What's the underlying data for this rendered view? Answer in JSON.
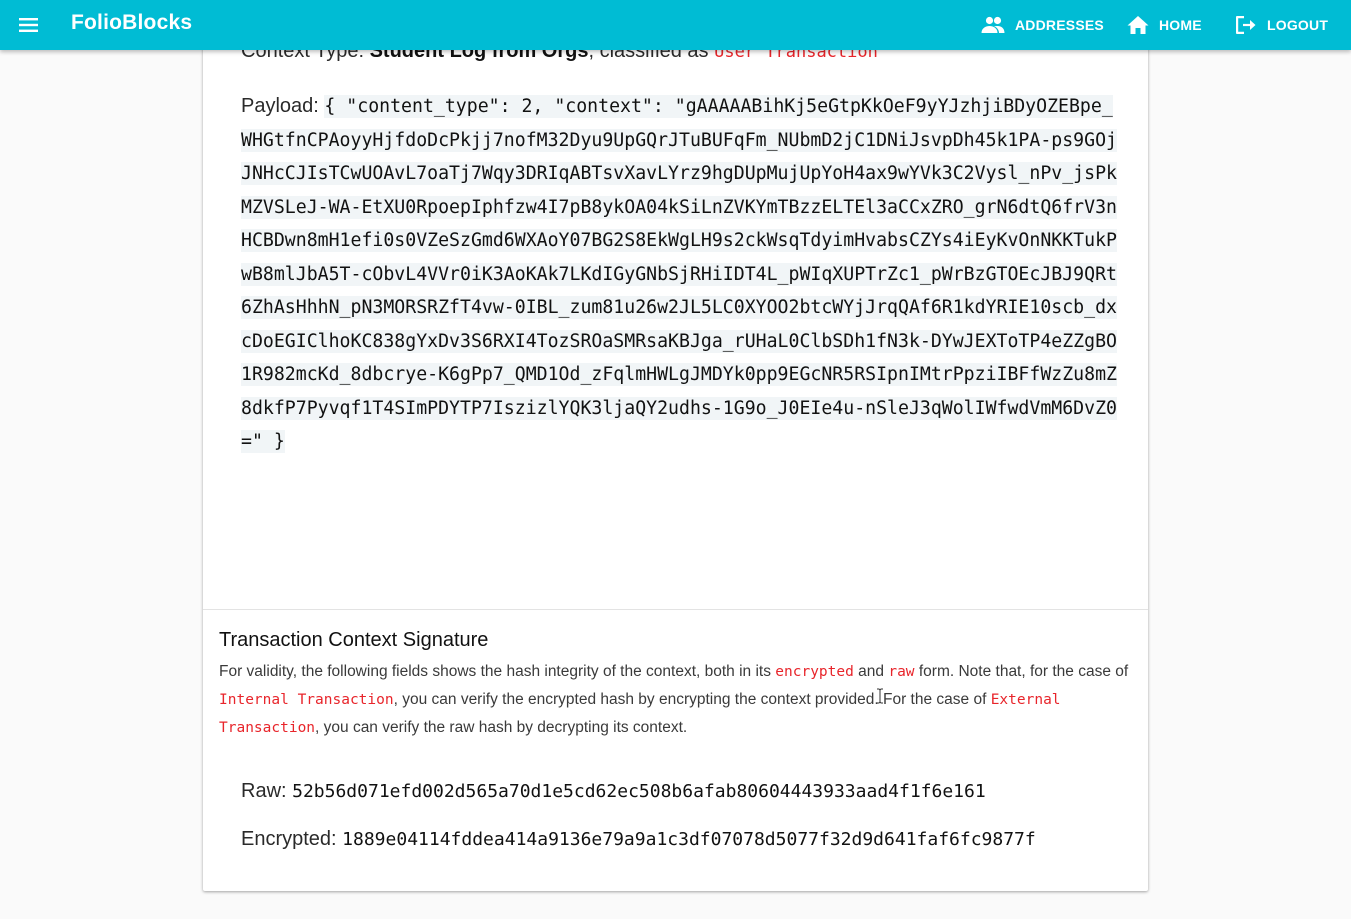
{
  "app": {
    "brand": "FolioBlocks",
    "accent": "#00bcd4"
  },
  "nav": {
    "addresses": "ADDRESSES",
    "home": "HOME",
    "logout": "LOGOUT"
  },
  "context": {
    "prefix": "Context Type: ",
    "type": "Student Log from Orgs",
    "middle": ", classified as ",
    "classification": "User Transaction"
  },
  "payload": {
    "label": "Payload: ",
    "value": "{ \"content_type\": 2, \"context\": \"gAAAAABihKj5eGtpKkOeF9yYJzhjiBDyOZEBpe_WHGtfnCPAoyyHjfdoDcPkjj7nofM32Dyu9UpGQrJTuBUFqFm_NUbmD2jC1DNiJsvpDh45k1PA-ps9GOjJNHcCJIsTCwUOAvL7oaTj7Wqy3DRIqABTsvXavLYrz9hgDUpMujUpYoH4ax9wYVk3C2Vysl_nPv_jsPkMZVSLeJ-WA-EtXU0RpoepIphfzw4I7pB8ykOA04kSiLnZVKYmTBzzELTEl3aCCxZRO_grN6dtQ6frV3nHCBDwn8mH1efi0s0VZeSzGmd6WXAoY07BG2S8EkWgLH9s2ckWsqTdyimHvabsCZYs4iEyKvOnNKKTukPwB8mlJbA5T-cObvL4VVr0iK3AoKAk7LKdIGyGNbSjRHiIDT4L_pWIqXUPTrZc1_pWrBzGTOEcJBJ9QRt6ZhAsHhhN_pN3MORSRZfT4vw-0IBL_zum81u26w2JL5LC0XYOO2btcWYjJrqQAf6R1kdYRIE10scb_dxcDoEGIClhoKC838gYxDv3S6RXI4TozSROaSMRsaKBJga_rUHaL0ClbSDh1fN3k-DYwJEXToTP4eZZgBO1R982mcKd_8dbcrye-K6gPp7_QMD1Od_zFqlmHWLgJMDYk0pp9EGcNR5RSIpnIMtrPpziIBFfWzZu8mZ8dkfP7Pyvqf1T4SImPDYTP7IszizlYQK3ljaQY2udhs-1G9o_J0EIe4u-nSleJ3qWolIWfwdVmM6DvZ0=\" }"
  },
  "signature": {
    "title": "Transaction Context Signature",
    "desc_1": "For validity, the following fields shows the hash integrity of the context, both in its ",
    "code_encrypted": "encrypted",
    "desc_2": " and ",
    "code_raw": "raw",
    "desc_3": " form. Note that, for the case of ",
    "code_internal": "Internal Transaction",
    "desc_4": ", you can verify the encrypted hash by encrypting the context provided. For the case of ",
    "code_external": "External Transaction",
    "desc_5": ", you can verify the raw hash by decrypting its context.",
    "raw_label": "Raw: ",
    "raw_value": "52b56d071efd002d565a70d1e5cd62ec508b6afab80604443933aad4f1f6e161",
    "encrypted_label": "Encrypted: ",
    "encrypted_value": "1889e04114fddea414a9136e79a9a1c3df07078d5077f32d9d641faf6fc9877f"
  },
  "icons": {
    "menu": "menu-icon",
    "addresses": "people-icon",
    "home": "home-icon",
    "logout": "logout-icon"
  }
}
